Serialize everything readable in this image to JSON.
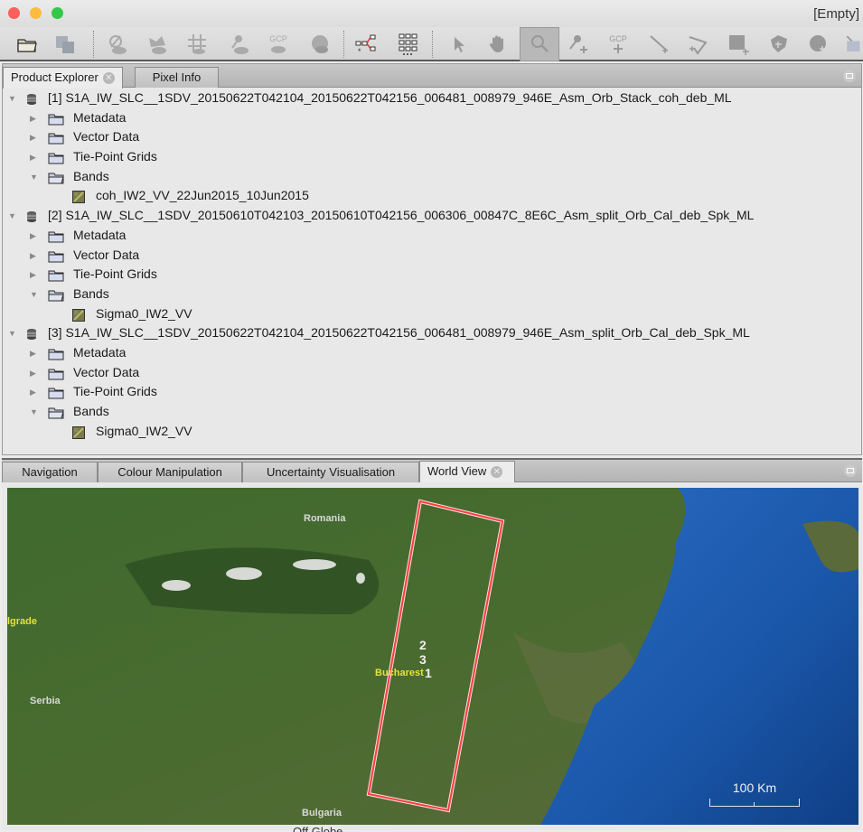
{
  "window": {
    "title": "[Empty]",
    "controls": [
      "close",
      "minimize",
      "zoom"
    ]
  },
  "toolbar": {
    "buttons": [
      {
        "icon": "open-product-icon",
        "enabled": true
      },
      {
        "icon": "save-product-icon",
        "enabled": false
      },
      {
        "icon": "no-data-overlay-icon",
        "enabled": false
      },
      {
        "icon": "world-map-overlay-icon",
        "enabled": false
      },
      {
        "icon": "graticule-overlay-icon",
        "enabled": false
      },
      {
        "icon": "pin-overlay-icon",
        "enabled": false
      },
      {
        "icon": "gcp-overlay-icon",
        "label": "GCP",
        "enabled": false
      },
      {
        "icon": "shape-overlay-icon",
        "enabled": false
      },
      {
        "icon": "graph-builder-icon",
        "enabled": true
      },
      {
        "icon": "batch-processing-icon",
        "enabled": true
      },
      {
        "icon": "select-tool-icon",
        "enabled": true
      },
      {
        "icon": "pan-tool-icon",
        "enabled": true
      },
      {
        "icon": "zoom-tool-icon",
        "enabled": true,
        "active": true
      },
      {
        "icon": "pin-placing-tool-icon",
        "enabled": true
      },
      {
        "icon": "gcp-placing-tool-icon",
        "label": "GCP",
        "enabled": true
      },
      {
        "icon": "line-drawing-tool-icon",
        "enabled": true
      },
      {
        "icon": "polyline-drawing-tool-icon",
        "enabled": true
      },
      {
        "icon": "rectangle-drawing-tool-icon",
        "enabled": true
      },
      {
        "icon": "polygon-drawing-tool-icon",
        "enabled": true
      },
      {
        "icon": "ellipse-drawing-tool-icon",
        "enabled": true
      },
      {
        "icon": "insert-figure-tool-icon",
        "enabled": true
      }
    ]
  },
  "top_panel": {
    "tabs": [
      {
        "label": "Product Explorer",
        "active": true,
        "closable": true
      },
      {
        "label": "Pixel Info",
        "active": false,
        "closable": false
      }
    ],
    "products": [
      {
        "label": "[1] S1A_IW_SLC__1SDV_20150622T042104_20150622T042156_006481_008979_946E_Asm_Orb_Stack_coh_deb_ML",
        "expanded": true,
        "children": [
          {
            "label": "Metadata",
            "expanded": false
          },
          {
            "label": "Vector Data",
            "expanded": false
          },
          {
            "label": "Tie-Point Grids",
            "expanded": false
          },
          {
            "label": "Bands",
            "expanded": true,
            "items": [
              "coh_IW2_VV_22Jun2015_10Jun2015"
            ]
          }
        ]
      },
      {
        "label": "[2] S1A_IW_SLC__1SDV_20150610T042103_20150610T042156_006306_00847C_8E6C_Asm_split_Orb_Cal_deb_Spk_ML",
        "expanded": true,
        "children": [
          {
            "label": "Metadata",
            "expanded": false
          },
          {
            "label": "Vector Data",
            "expanded": false
          },
          {
            "label": "Tie-Point Grids",
            "expanded": false
          },
          {
            "label": "Bands",
            "expanded": true,
            "items": [
              "Sigma0_IW2_VV"
            ]
          }
        ]
      },
      {
        "label": "[3] S1A_IW_SLC__1SDV_20150622T042104_20150622T042156_006481_008979_946E_Asm_split_Orb_Cal_deb_Spk_ML",
        "expanded": true,
        "children": [
          {
            "label": "Metadata",
            "expanded": false
          },
          {
            "label": "Vector Data",
            "expanded": false
          },
          {
            "label": "Tie-Point Grids",
            "expanded": false
          },
          {
            "label": "Bands",
            "expanded": true,
            "items": [
              "Sigma0_IW2_VV"
            ]
          }
        ]
      }
    ]
  },
  "bottom_panel": {
    "tabs": [
      {
        "label": "Navigation",
        "active": false,
        "closable": false
      },
      {
        "label": "Colour Manipulation",
        "active": false,
        "closable": false
      },
      {
        "label": "Uncertainty Visualisation",
        "active": false,
        "closable": false
      },
      {
        "label": "World View",
        "active": true,
        "closable": true
      }
    ],
    "world_view": {
      "country_labels": [
        "Romania",
        "Serbia",
        "Bulgaria"
      ],
      "city_labels": [
        "lgrade",
        "Bucharest"
      ],
      "footprint_numbers": [
        "2",
        "3",
        "1"
      ],
      "footprint_color": "#ff4a4a",
      "scale_label": "100 Km",
      "status_text": "Off Globe"
    }
  },
  "colors": {
    "land": "#4d6b34",
    "sea": "#1f5cb0",
    "city_label": "#e3e33a",
    "footprint": "#ff4a4a"
  }
}
